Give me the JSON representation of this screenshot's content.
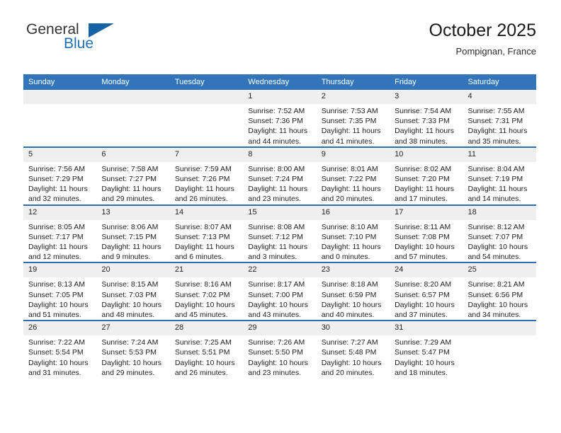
{
  "brand": {
    "name_part1": "General",
    "name_part2": "Blue",
    "logo_icon": "blue-triangle-icon"
  },
  "header": {
    "title": "October 2025",
    "subtitle": "Pompignan, France"
  },
  "colors": {
    "header_blue": "#3275b9",
    "row_divider_blue": "#2f6fb0",
    "daynum_band": "#efefef",
    "brand_blue": "#1464a5"
  },
  "weekday_headers": [
    "Sunday",
    "Monday",
    "Tuesday",
    "Wednesday",
    "Thursday",
    "Friday",
    "Saturday"
  ],
  "labels": {
    "sunrise_prefix": "Sunrise: ",
    "sunset_prefix": "Sunset: ",
    "daylight_prefix": "Daylight: "
  },
  "weeks": [
    [
      {
        "day": "",
        "sunrise": "",
        "sunset": "",
        "daylight": ""
      },
      {
        "day": "",
        "sunrise": "",
        "sunset": "",
        "daylight": ""
      },
      {
        "day": "",
        "sunrise": "",
        "sunset": "",
        "daylight": ""
      },
      {
        "day": "1",
        "sunrise": "Sunrise: 7:52 AM",
        "sunset": "Sunset: 7:36 PM",
        "daylight": "Daylight: 11 hours and 44 minutes."
      },
      {
        "day": "2",
        "sunrise": "Sunrise: 7:53 AM",
        "sunset": "Sunset: 7:35 PM",
        "daylight": "Daylight: 11 hours and 41 minutes."
      },
      {
        "day": "3",
        "sunrise": "Sunrise: 7:54 AM",
        "sunset": "Sunset: 7:33 PM",
        "daylight": "Daylight: 11 hours and 38 minutes."
      },
      {
        "day": "4",
        "sunrise": "Sunrise: 7:55 AM",
        "sunset": "Sunset: 7:31 PM",
        "daylight": "Daylight: 11 hours and 35 minutes."
      }
    ],
    [
      {
        "day": "5",
        "sunrise": "Sunrise: 7:56 AM",
        "sunset": "Sunset: 7:29 PM",
        "daylight": "Daylight: 11 hours and 32 minutes."
      },
      {
        "day": "6",
        "sunrise": "Sunrise: 7:58 AM",
        "sunset": "Sunset: 7:27 PM",
        "daylight": "Daylight: 11 hours and 29 minutes."
      },
      {
        "day": "7",
        "sunrise": "Sunrise: 7:59 AM",
        "sunset": "Sunset: 7:26 PM",
        "daylight": "Daylight: 11 hours and 26 minutes."
      },
      {
        "day": "8",
        "sunrise": "Sunrise: 8:00 AM",
        "sunset": "Sunset: 7:24 PM",
        "daylight": "Daylight: 11 hours and 23 minutes."
      },
      {
        "day": "9",
        "sunrise": "Sunrise: 8:01 AM",
        "sunset": "Sunset: 7:22 PM",
        "daylight": "Daylight: 11 hours and 20 minutes."
      },
      {
        "day": "10",
        "sunrise": "Sunrise: 8:02 AM",
        "sunset": "Sunset: 7:20 PM",
        "daylight": "Daylight: 11 hours and 17 minutes."
      },
      {
        "day": "11",
        "sunrise": "Sunrise: 8:04 AM",
        "sunset": "Sunset: 7:19 PM",
        "daylight": "Daylight: 11 hours and 14 minutes."
      }
    ],
    [
      {
        "day": "12",
        "sunrise": "Sunrise: 8:05 AM",
        "sunset": "Sunset: 7:17 PM",
        "daylight": "Daylight: 11 hours and 12 minutes."
      },
      {
        "day": "13",
        "sunrise": "Sunrise: 8:06 AM",
        "sunset": "Sunset: 7:15 PM",
        "daylight": "Daylight: 11 hours and 9 minutes."
      },
      {
        "day": "14",
        "sunrise": "Sunrise: 8:07 AM",
        "sunset": "Sunset: 7:13 PM",
        "daylight": "Daylight: 11 hours and 6 minutes."
      },
      {
        "day": "15",
        "sunrise": "Sunrise: 8:08 AM",
        "sunset": "Sunset: 7:12 PM",
        "daylight": "Daylight: 11 hours and 3 minutes."
      },
      {
        "day": "16",
        "sunrise": "Sunrise: 8:10 AM",
        "sunset": "Sunset: 7:10 PM",
        "daylight": "Daylight: 11 hours and 0 minutes."
      },
      {
        "day": "17",
        "sunrise": "Sunrise: 8:11 AM",
        "sunset": "Sunset: 7:08 PM",
        "daylight": "Daylight: 10 hours and 57 minutes."
      },
      {
        "day": "18",
        "sunrise": "Sunrise: 8:12 AM",
        "sunset": "Sunset: 7:07 PM",
        "daylight": "Daylight: 10 hours and 54 minutes."
      }
    ],
    [
      {
        "day": "19",
        "sunrise": "Sunrise: 8:13 AM",
        "sunset": "Sunset: 7:05 PM",
        "daylight": "Daylight: 10 hours and 51 minutes."
      },
      {
        "day": "20",
        "sunrise": "Sunrise: 8:15 AM",
        "sunset": "Sunset: 7:03 PM",
        "daylight": "Daylight: 10 hours and 48 minutes."
      },
      {
        "day": "21",
        "sunrise": "Sunrise: 8:16 AM",
        "sunset": "Sunset: 7:02 PM",
        "daylight": "Daylight: 10 hours and 45 minutes."
      },
      {
        "day": "22",
        "sunrise": "Sunrise: 8:17 AM",
        "sunset": "Sunset: 7:00 PM",
        "daylight": "Daylight: 10 hours and 43 minutes."
      },
      {
        "day": "23",
        "sunrise": "Sunrise: 8:18 AM",
        "sunset": "Sunset: 6:59 PM",
        "daylight": "Daylight: 10 hours and 40 minutes."
      },
      {
        "day": "24",
        "sunrise": "Sunrise: 8:20 AM",
        "sunset": "Sunset: 6:57 PM",
        "daylight": "Daylight: 10 hours and 37 minutes."
      },
      {
        "day": "25",
        "sunrise": "Sunrise: 8:21 AM",
        "sunset": "Sunset: 6:56 PM",
        "daylight": "Daylight: 10 hours and 34 minutes."
      }
    ],
    [
      {
        "day": "26",
        "sunrise": "Sunrise: 7:22 AM",
        "sunset": "Sunset: 5:54 PM",
        "daylight": "Daylight: 10 hours and 31 minutes."
      },
      {
        "day": "27",
        "sunrise": "Sunrise: 7:24 AM",
        "sunset": "Sunset: 5:53 PM",
        "daylight": "Daylight: 10 hours and 29 minutes."
      },
      {
        "day": "28",
        "sunrise": "Sunrise: 7:25 AM",
        "sunset": "Sunset: 5:51 PM",
        "daylight": "Daylight: 10 hours and 26 minutes."
      },
      {
        "day": "29",
        "sunrise": "Sunrise: 7:26 AM",
        "sunset": "Sunset: 5:50 PM",
        "daylight": "Daylight: 10 hours and 23 minutes."
      },
      {
        "day": "30",
        "sunrise": "Sunrise: 7:27 AM",
        "sunset": "Sunset: 5:48 PM",
        "daylight": "Daylight: 10 hours and 20 minutes."
      },
      {
        "day": "31",
        "sunrise": "Sunrise: 7:29 AM",
        "sunset": "Sunset: 5:47 PM",
        "daylight": "Daylight: 10 hours and 18 minutes."
      },
      {
        "day": "",
        "sunrise": "",
        "sunset": "",
        "daylight": ""
      }
    ]
  ]
}
